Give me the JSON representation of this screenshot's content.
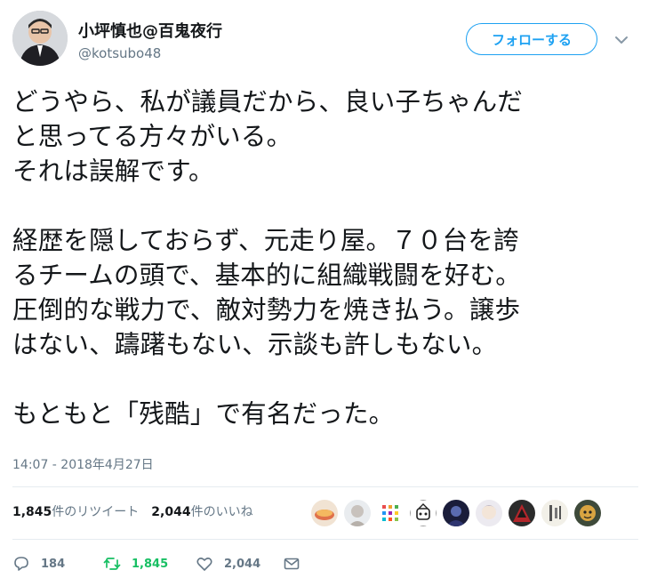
{
  "user": {
    "display_name": "小坪慎也@百鬼夜行",
    "handle": "@kotsubo48",
    "follow_label": "フォローする"
  },
  "tweet": {
    "lines": [
      "どうやら、私が議員だから、良い子ちゃんだ",
      "と思ってる方々がいる。",
      "それは誤解です。",
      "",
      "経歴を隠しておらず、元走り屋。７０台を誇",
      "るチームの頭で、基本的に組織戦闘を好む。",
      "圧倒的な戦力で、敵対勢力を焼き払う。譲歩",
      "はない、躊躇もない、示談も許しもない。",
      "",
      "もともと「残酷」で有名だった。"
    ],
    "timestamp": "14:07 - 2018年4月27日"
  },
  "stats": {
    "retweet_count": "1,845",
    "retweet_label": "件のリツイート",
    "like_count": "2,044",
    "like_label": "件のいいね"
  },
  "actions": {
    "reply_count": "184",
    "retweet_count": "1,845",
    "like_count": "2,044"
  },
  "colors": {
    "accent": "#1da1f2",
    "retweet_green": "#17bf63",
    "muted": "#657786"
  }
}
